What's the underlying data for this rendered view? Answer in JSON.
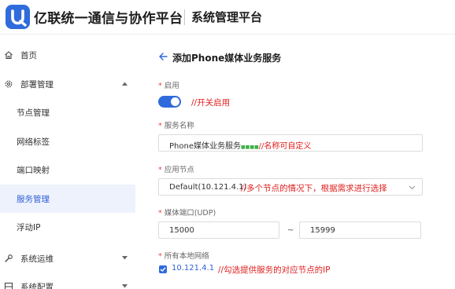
{
  "header": {
    "brand": "亿联统一通信与协作平台",
    "subtitle": "系统管理平台"
  },
  "sidebar": {
    "items": [
      {
        "label": "首页",
        "icon": "home-icon"
      },
      {
        "label": "部署管理",
        "icon": "gear-icon",
        "expanded": true
      },
      {
        "label": "节点管理"
      },
      {
        "label": "网络标签"
      },
      {
        "label": "端口映射"
      },
      {
        "label": "服务管理",
        "active": true
      },
      {
        "label": "浮动IP"
      },
      {
        "label": "系统运维",
        "icon": "wrench-icon",
        "expanded": false
      },
      {
        "label": "系统配置",
        "icon": "grid-icon",
        "expanded": false
      }
    ]
  },
  "main": {
    "title": "添加Phone媒体业务服务",
    "enable": {
      "label": "启用",
      "required": "*",
      "state": "on",
      "note": "//开关启用"
    },
    "service_name": {
      "label": "服务名称",
      "required": "*",
      "value": "Phone媒体业务服务",
      "note_small": "■■■■",
      "note": "//名称可自定义"
    },
    "node": {
      "label": "应用节点",
      "required": "*",
      "value": "Default(10.121.4.1)",
      "note": "//多个节点的情况下，根据需求进行选择"
    },
    "port": {
      "label": "媒体端口(UDP)",
      "required": "*",
      "from": "15000",
      "separator": "~",
      "to": "15999"
    },
    "network": {
      "label": "所有本地网络",
      "required": "*",
      "ip": "10.121.4.1",
      "checked": true,
      "note": "//勾选提供服务的对应节点的IP"
    }
  },
  "colors": {
    "accent": "#2f6bdc",
    "annotation": "#e02020",
    "active_bg": "#eef2fc"
  }
}
